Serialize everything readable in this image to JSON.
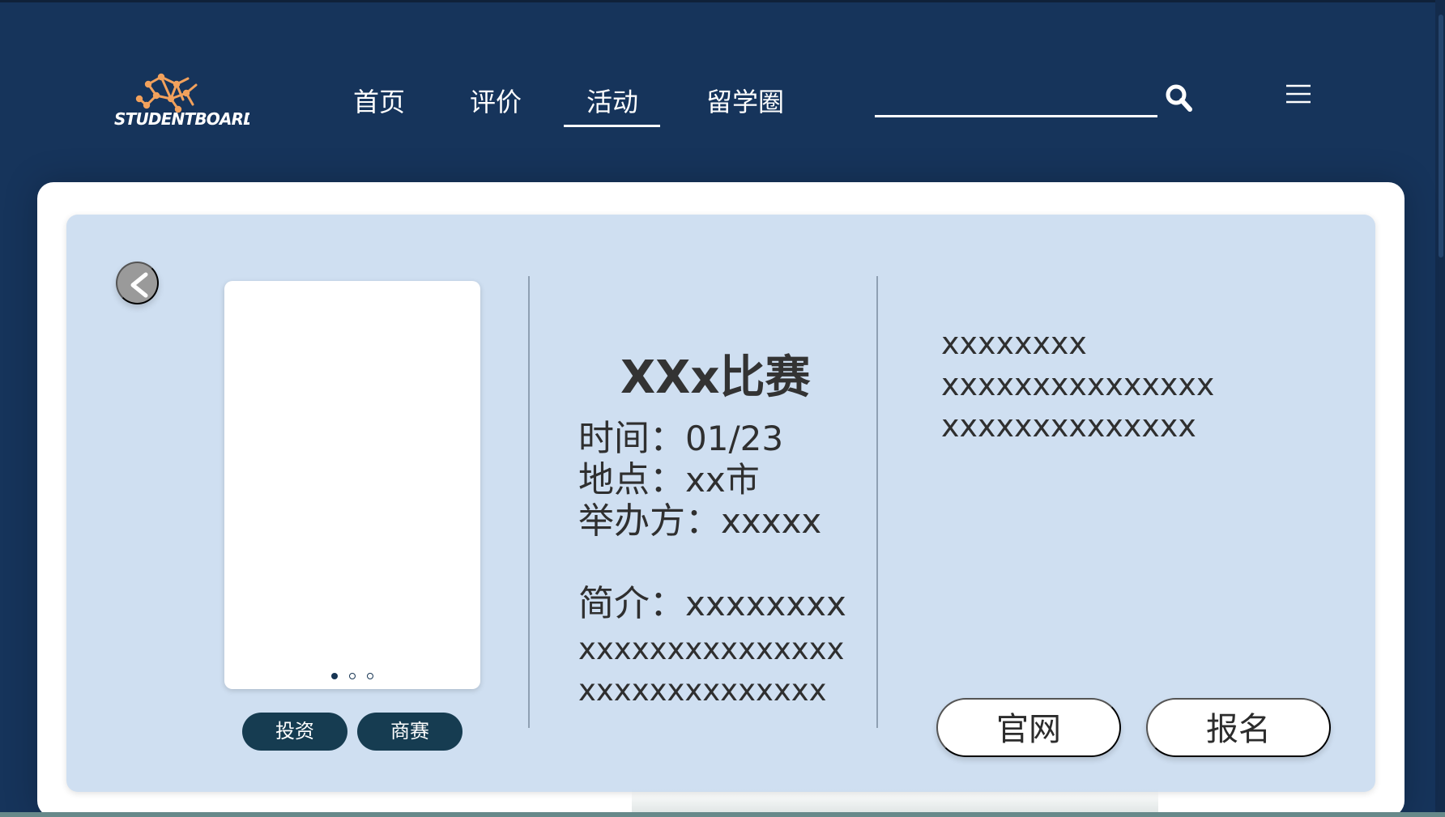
{
  "app": {
    "brand_name": "StudentBoard®",
    "brand_color": "#16345b",
    "accent_color": "#f2a15c",
    "panel_color": "#cfdff1"
  },
  "navigation": {
    "items": [
      {
        "label": "首页",
        "active": false
      },
      {
        "label": "评价",
        "active": false
      },
      {
        "label": "活动",
        "active": true
      },
      {
        "label": "留学圈",
        "active": false
      }
    ],
    "search_icon": "search-icon",
    "menu_icon": "menu-icon"
  },
  "activity": {
    "title": "XXx比赛",
    "time_label": "时间：",
    "time_value": "01/23",
    "location_label": "地点：",
    "location_value": "xx市",
    "organizer_label": "举办方：",
    "organizer_value": "xxxxx",
    "intro_label": "简介：",
    "intro_lines": [
      "xxxxxxxx",
      "xxxxxxxxxxxxxxx",
      "xxxxxxxxxxxxxx"
    ],
    "side_lines": [
      "xxxxxxxx",
      "xxxxxxxxxxxxxxx",
      "xxxxxxxxxxxxxx"
    ],
    "tags": [
      "投资",
      "商赛"
    ],
    "actions": {
      "website": "官网",
      "signup": "报名"
    }
  },
  "carousel": {
    "active_index": 0,
    "total": 3
  }
}
